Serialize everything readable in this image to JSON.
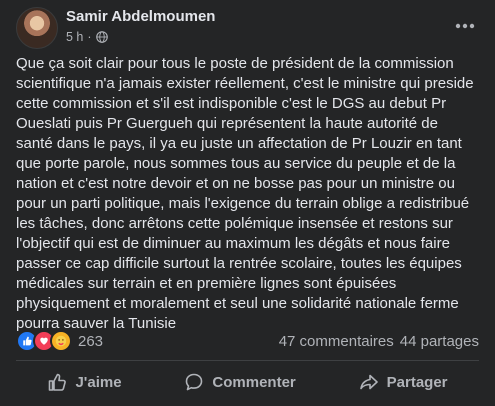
{
  "post": {
    "author": "Samir Abdelmoumen",
    "time": "5 h",
    "dot": "·",
    "text": "Que ça soit clair pour tous le poste de président de la commission scientifique n'a jamais exister réellement, c'est le ministre qui preside cette commission et s'il est indisponible c'est le DGS au debut Pr Oueslati puis Pr Guergueh qui représentent la haute autorité de santé dans le pays, il ya eu juste un affectation de Pr Louzir en tant que porte parole, nous sommes tous au service du peuple et de la nation et c'est notre devoir et on ne bosse pas pour un ministre ou pour un parti politique, mais l'exigence du terrain oblige a redistribué les tâches, donc arrêtons cette polémique insensée et restons sur l'objectif qui est de diminuer au maximum les dégâts et nous faire passer ce cap difficile surtout la rentrée scolaire, toutes les équipes médicales sur terrain et en première lignes sont épuisées physiquement et moralement et seul une solidarité nationale ferme pourra sauver la Tunisie"
  },
  "stats": {
    "reaction_count": "263",
    "comments": "47 commentaires",
    "shares": "44 partages"
  },
  "actions": {
    "like": "J'aime",
    "comment": "Commenter",
    "share": "Partager"
  },
  "icons": {
    "more": "more-options-icon",
    "privacy": "globe-icon",
    "reactions": [
      "like-reaction-icon",
      "love-reaction-icon",
      "care-reaction-icon"
    ]
  }
}
